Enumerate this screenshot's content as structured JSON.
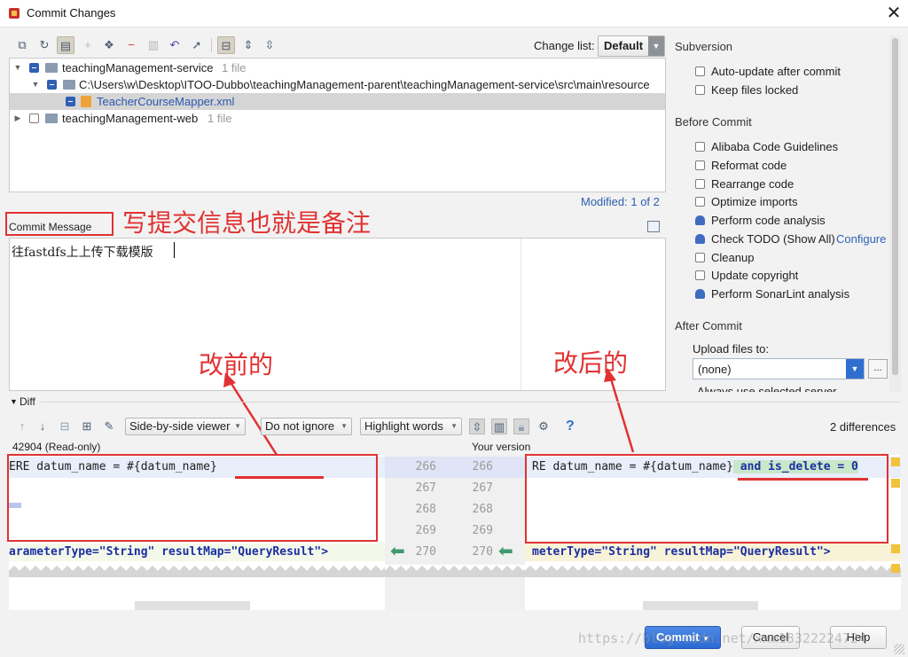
{
  "window": {
    "title": "Commit Changes",
    "close_glyph": "✕"
  },
  "toolbar": {
    "icons": [
      "show-diff-icon",
      "refresh-icon",
      "changelist-icon",
      "add-icon",
      "move-icon",
      "remove-icon",
      "group-icon",
      "rollback-icon",
      "jump-to-source-icon",
      "expand-toggle-icon",
      "expand-all-icon",
      "collapse-all-icon"
    ],
    "change_list_label": "Change list:",
    "change_list_value": "Default"
  },
  "tree": {
    "rows": [
      {
        "label": "teachingManagement-service",
        "count": "1 file"
      },
      {
        "label": "C:\\Users\\w\\Desktop\\ITOO-Dubbo\\teachingManagement-parent\\teachingManagement-service\\src\\main\\resource"
      },
      {
        "label": "TeacherCourseMapper.xml"
      },
      {
        "label": "teachingManagement-web",
        "count": "1 file"
      }
    ]
  },
  "modified_text": "Modified: 1 of 2",
  "commit_message": {
    "label": "Commit Message",
    "text": "往fastdfs上上传下载模版"
  },
  "annotations": {
    "commit_note": "写提交信息也就是备注",
    "before": "改前的",
    "after": "改后的"
  },
  "subversion": {
    "header": "Subversion",
    "options": [
      {
        "label": "Auto-update after commit",
        "checked": false
      },
      {
        "label": "Keep files locked",
        "checked": false
      }
    ]
  },
  "before_commit": {
    "header": "Before Commit",
    "options": [
      {
        "label": "Alibaba Code Guidelines",
        "checked": false
      },
      {
        "label": "Reformat code",
        "checked": false
      },
      {
        "label": "Rearrange code",
        "checked": false
      },
      {
        "label": "Optimize imports",
        "checked": false
      },
      {
        "label": "Perform code analysis",
        "checked": true
      },
      {
        "label": "Check TODO (Show All)",
        "checked": true,
        "link": "Configure"
      },
      {
        "label": "Cleanup",
        "checked": false
      },
      {
        "label": "Update copyright",
        "checked": false
      },
      {
        "label": "Perform SonarLint analysis",
        "checked": true
      }
    ]
  },
  "after_commit": {
    "header": "After Commit",
    "upload_label": "Upload files to:",
    "upload_value": "(none)",
    "upload_more": "...",
    "partial_option": "Always use selected server"
  },
  "diff": {
    "label": "Diff",
    "viewer_mode": "Side-by-side viewer",
    "whitespace_mode": "Do not ignore",
    "highlight_mode": "Highlight words",
    "help": "?",
    "differences": "2 differences",
    "left_title": "42904 (Read-only)",
    "right_title": "Your version",
    "left_line_266": "ERE datum_name = #{datum_name}",
    "right_line_266_base": "RE datum_name = #{datum_name}",
    "right_line_266_added": " and is_delete = 0",
    "left_line_270": "arameterType=\"String\" resultMap=\"QueryResult\">",
    "right_line_270": "meterType=\"String\" resultMap=\"QueryResult\">",
    "left_line_numbers": [
      "266",
      "267",
      "268",
      "269",
      "270"
    ],
    "right_line_numbers": [
      "266",
      "267",
      "268",
      "269",
      "270"
    ]
  },
  "buttons": {
    "commit": "Commit",
    "cancel": "Cancel",
    "help": "Help"
  },
  "watermark": "https://blog.csdn.net/xxm18322224724"
}
